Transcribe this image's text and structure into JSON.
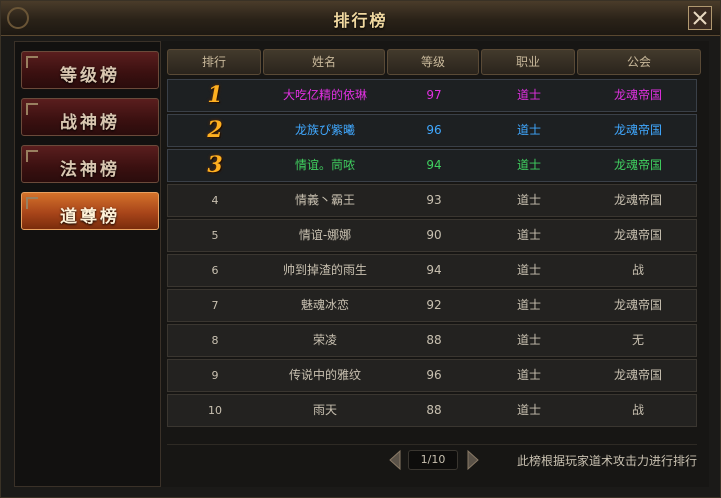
{
  "window": {
    "title": "排行榜"
  },
  "tabs": [
    {
      "label": "等级榜",
      "active": false
    },
    {
      "label": "战神榜",
      "active": false
    },
    {
      "label": "法神榜",
      "active": false
    },
    {
      "label": "道尊榜",
      "active": true
    }
  ],
  "table": {
    "headers": [
      "排行",
      "姓名",
      "等级",
      "职业",
      "公会"
    ],
    "rows": [
      {
        "rank": "1",
        "name": "大吃亿精的依琳",
        "level": "97",
        "class": "道士",
        "guild": "龙魂帝国",
        "color": "#e030e0"
      },
      {
        "rank": "2",
        "name": "龙族ぴ紫曦",
        "level": "96",
        "class": "道士",
        "guild": "龙魂帝国",
        "color": "#40a8ff"
      },
      {
        "rank": "3",
        "name": "情谊。茼哝",
        "level": "94",
        "class": "道士",
        "guild": "龙魂帝国",
        "color": "#40d060"
      },
      {
        "rank": "4",
        "name": "情義丶霸王",
        "level": "93",
        "class": "道士",
        "guild": "龙魂帝国",
        "color": "#c8c0b0"
      },
      {
        "rank": "5",
        "name": "情谊-娜娜",
        "level": "90",
        "class": "道士",
        "guild": "龙魂帝国",
        "color": "#c8c0b0"
      },
      {
        "rank": "6",
        "name": "帅到掉渣的雨生",
        "level": "94",
        "class": "道士",
        "guild": "战",
        "color": "#c8c0b0"
      },
      {
        "rank": "7",
        "name": "魅魂冰恋",
        "level": "92",
        "class": "道士",
        "guild": "龙魂帝国",
        "color": "#c8c0b0"
      },
      {
        "rank": "8",
        "name": "荣凌",
        "level": "88",
        "class": "道士",
        "guild": "无",
        "color": "#c8c0b0"
      },
      {
        "rank": "9",
        "name": "传说中的雅纹",
        "level": "96",
        "class": "道士",
        "guild": "龙魂帝国",
        "color": "#c8c0b0"
      },
      {
        "rank": "10",
        "name": "雨天",
        "level": "88",
        "class": "道士",
        "guild": "战",
        "color": "#c8c0b0"
      }
    ]
  },
  "pager": {
    "page": "1/10"
  },
  "footer": {
    "note": "此榜根据玩家道术攻击力进行排行"
  }
}
